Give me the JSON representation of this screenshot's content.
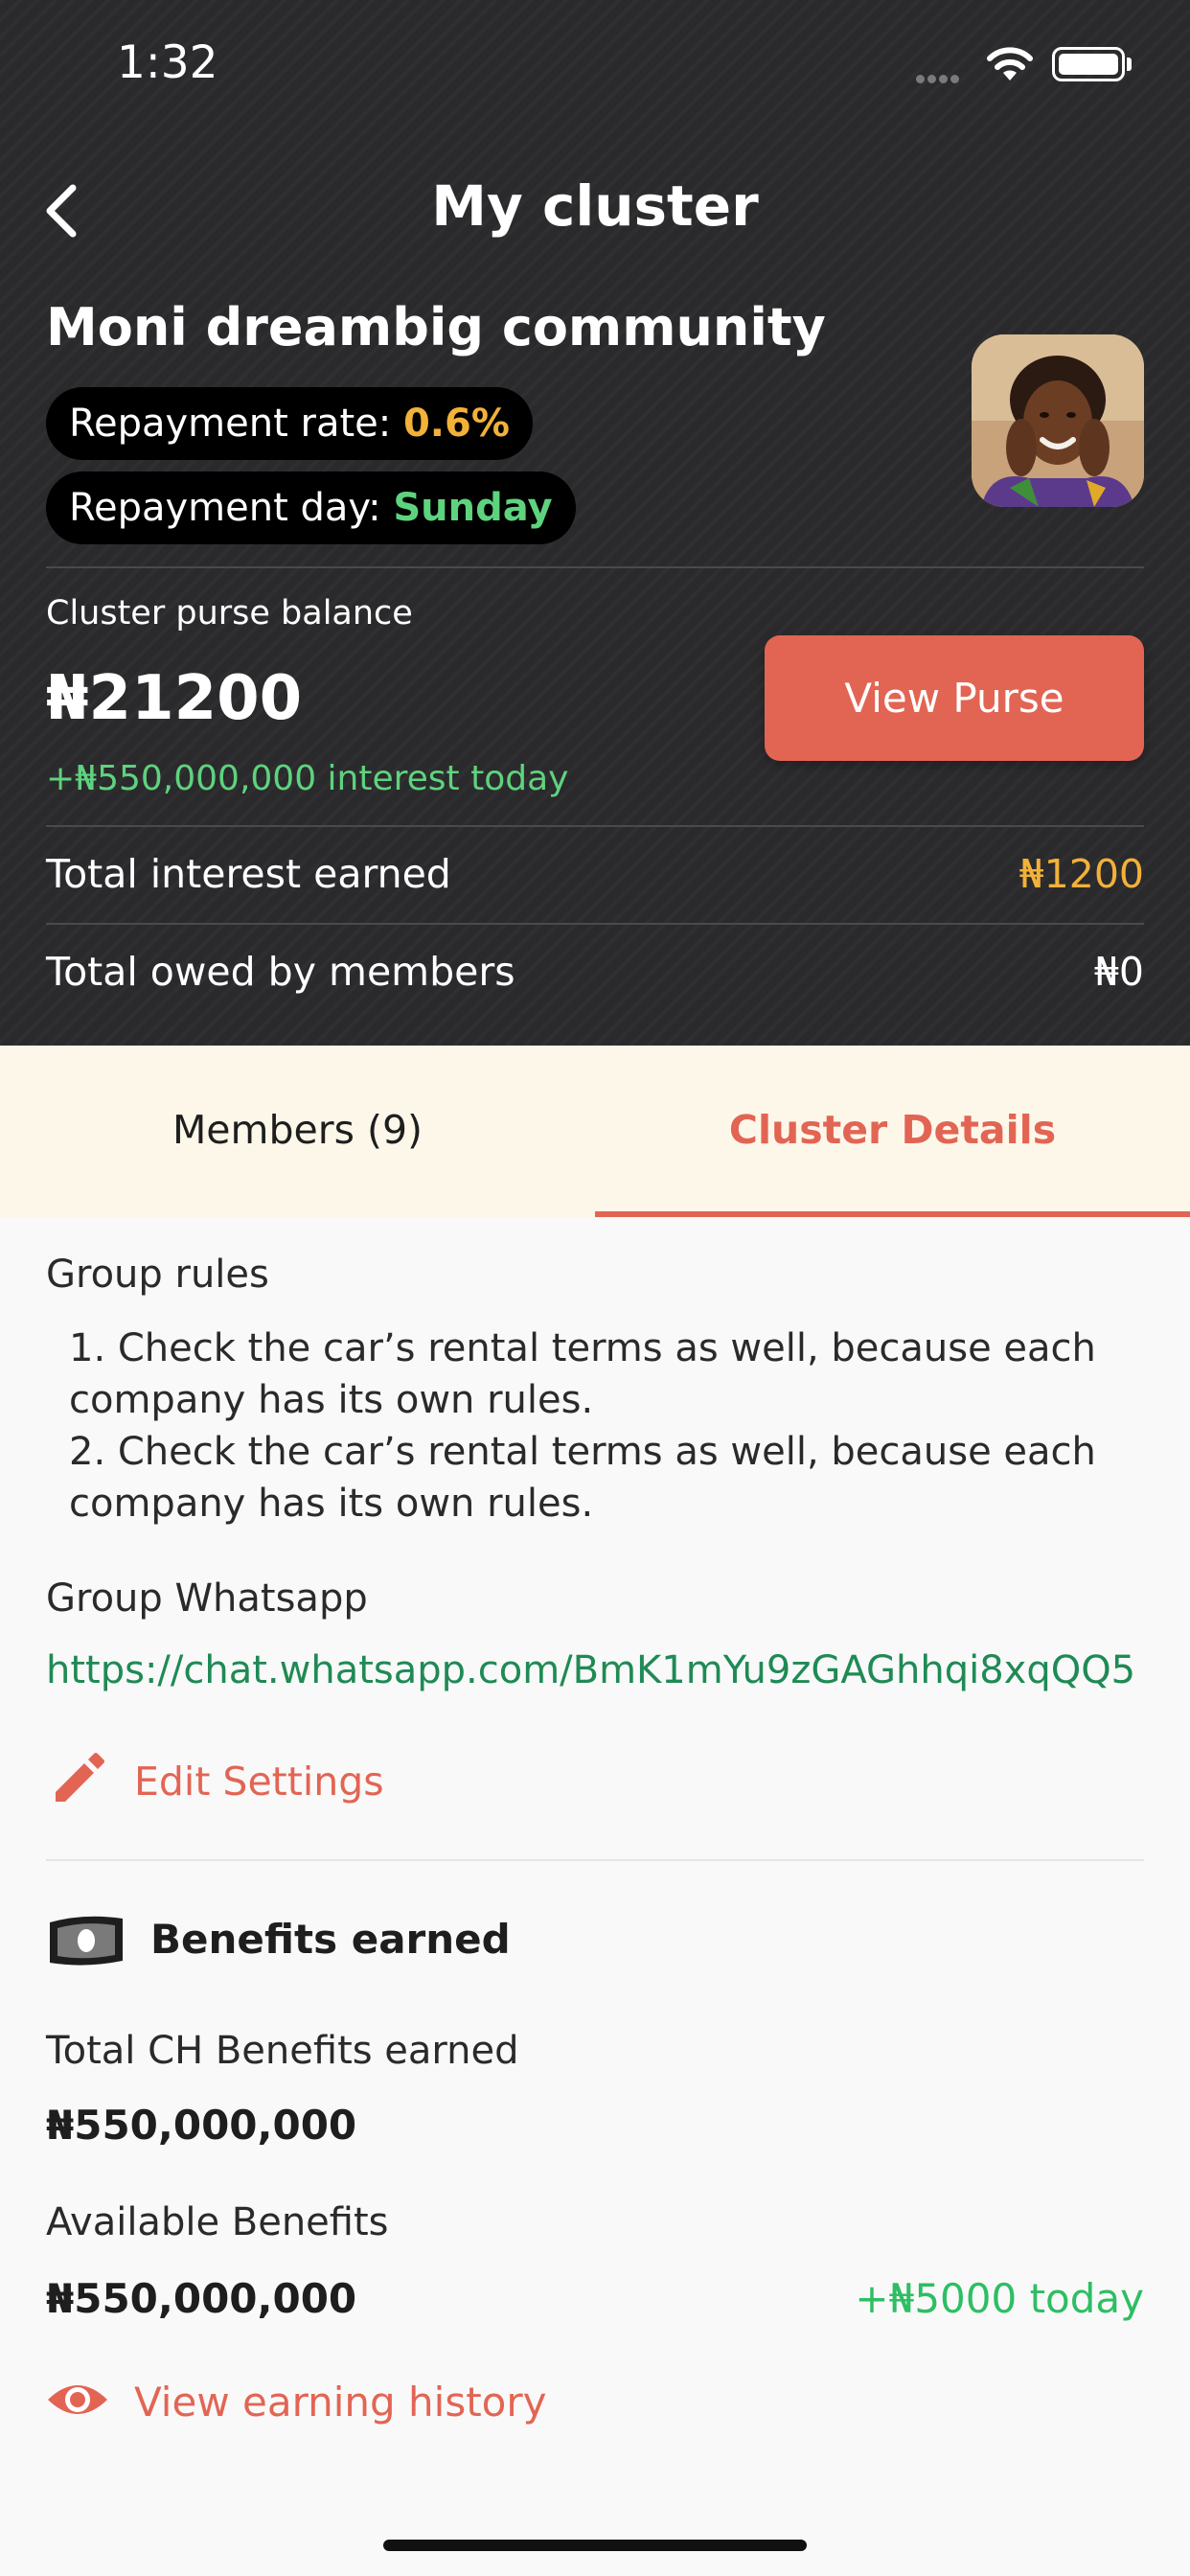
{
  "status_bar": {
    "time": "1:32"
  },
  "nav": {
    "title": "My cluster"
  },
  "cluster": {
    "name": "Moni dreambig community",
    "repayment_rate_label": "Repayment rate:",
    "repayment_rate_value": "0.6%",
    "repayment_day_label": "Repayment day:",
    "repayment_day_value": "Sunday"
  },
  "purse": {
    "label": "Cluster purse balance",
    "balance": "₦21200",
    "interest_today": "+₦550,000,000 interest today",
    "view_button": "View Purse"
  },
  "summary": {
    "interest_label": "Total interest earned",
    "interest_value": "₦1200",
    "owed_label": "Total owed by members",
    "owed_value": "₦0"
  },
  "tabs": {
    "members": "Members (9)",
    "details": "Cluster Details",
    "active": "details"
  },
  "details": {
    "rules_label": "Group rules",
    "rules": [
      "1. Check the car’s rental terms as well, because each company has its own rules.",
      "2. Check the car’s rental terms as well, because each company has its own rules."
    ],
    "whatsapp_label": "Group Whatsapp",
    "whatsapp_link": "https://chat.whatsapp.com/BmK1mYu9zGAGhhqi8xqQQ5",
    "edit_settings": "Edit Settings"
  },
  "benefits": {
    "title": "Benefits earned",
    "total_label": "Total CH Benefits earned",
    "total_value": "₦550,000,000",
    "available_label": "Available Benefits",
    "available_value": "₦550,000,000",
    "available_today": "+₦5000 today",
    "history_link": "View earning history"
  },
  "colors": {
    "accent": "#E26554",
    "header_bg": "#2A2A2C",
    "positive": "#5ED37E",
    "rate": "#F2B138",
    "link": "#1F8A55",
    "tab_bg": "#FDF7EA"
  },
  "icons": [
    "back-chevron-icon",
    "wifi-icon",
    "battery-icon",
    "pencil-icon",
    "money-icon",
    "eye-icon"
  ]
}
